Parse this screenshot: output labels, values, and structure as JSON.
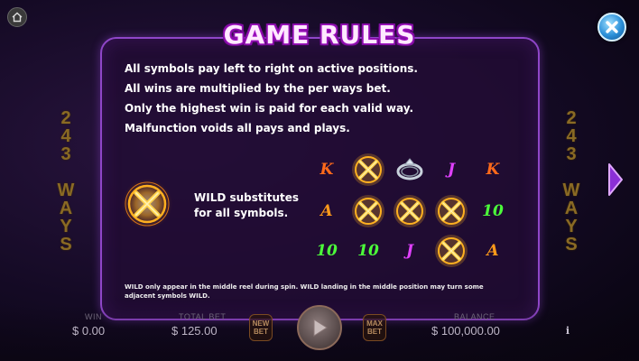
{
  "title": "GAME RULES",
  "side_label": "243 WAYS",
  "rules": [
    "All symbols pay left to right on active positions.",
    "All wins are multiplied by the per ways bet.",
    "Only the highest win is paid for each valid way.",
    "Malfunction voids all pays and plays."
  ],
  "wild": {
    "line1": "WILD substitutes",
    "line2": "for all symbols."
  },
  "grid": {
    "rows": [
      [
        "K",
        "WILD",
        "ring",
        "J",
        "K"
      ],
      [
        "A",
        "WILD",
        "WILD",
        "WILD",
        "10"
      ],
      [
        "10",
        "10",
        "J",
        "WILD",
        "A"
      ]
    ]
  },
  "footnote": {
    "line1": "WILD only appear in the middle reel during spin. WILD landing in the middle position may turn some",
    "line2": "adjacent symbols WILD."
  },
  "bottom_bar": {
    "win_label": "WIN",
    "win_value": "$ 0.00",
    "total_bet_label": "TOTAL BET",
    "total_bet_value": "$ 125.00",
    "new_bet_line1": "NEW",
    "new_bet_line2": "BET",
    "max_bet_line1": "MAX",
    "max_bet_line2": "BET",
    "balance_label": "BALANCE",
    "balance_value": "$ 100,000.00",
    "info_glyph": "i"
  },
  "colors": {
    "panel_border": "#8f46c8",
    "title_glow": "#b418d6",
    "K": "#ff6a1a",
    "A": "#ff9a1a",
    "J": "#e040ff",
    "10": "#4cff3a",
    "wild_gold": "#ffb020"
  },
  "icons": {
    "home": "home-icon",
    "close": "close-icon",
    "next": "next-page-arrow-icon",
    "spin": "play-triangle-icon",
    "wild": "wild-x-icon",
    "ring": "silver-ring-icon"
  }
}
